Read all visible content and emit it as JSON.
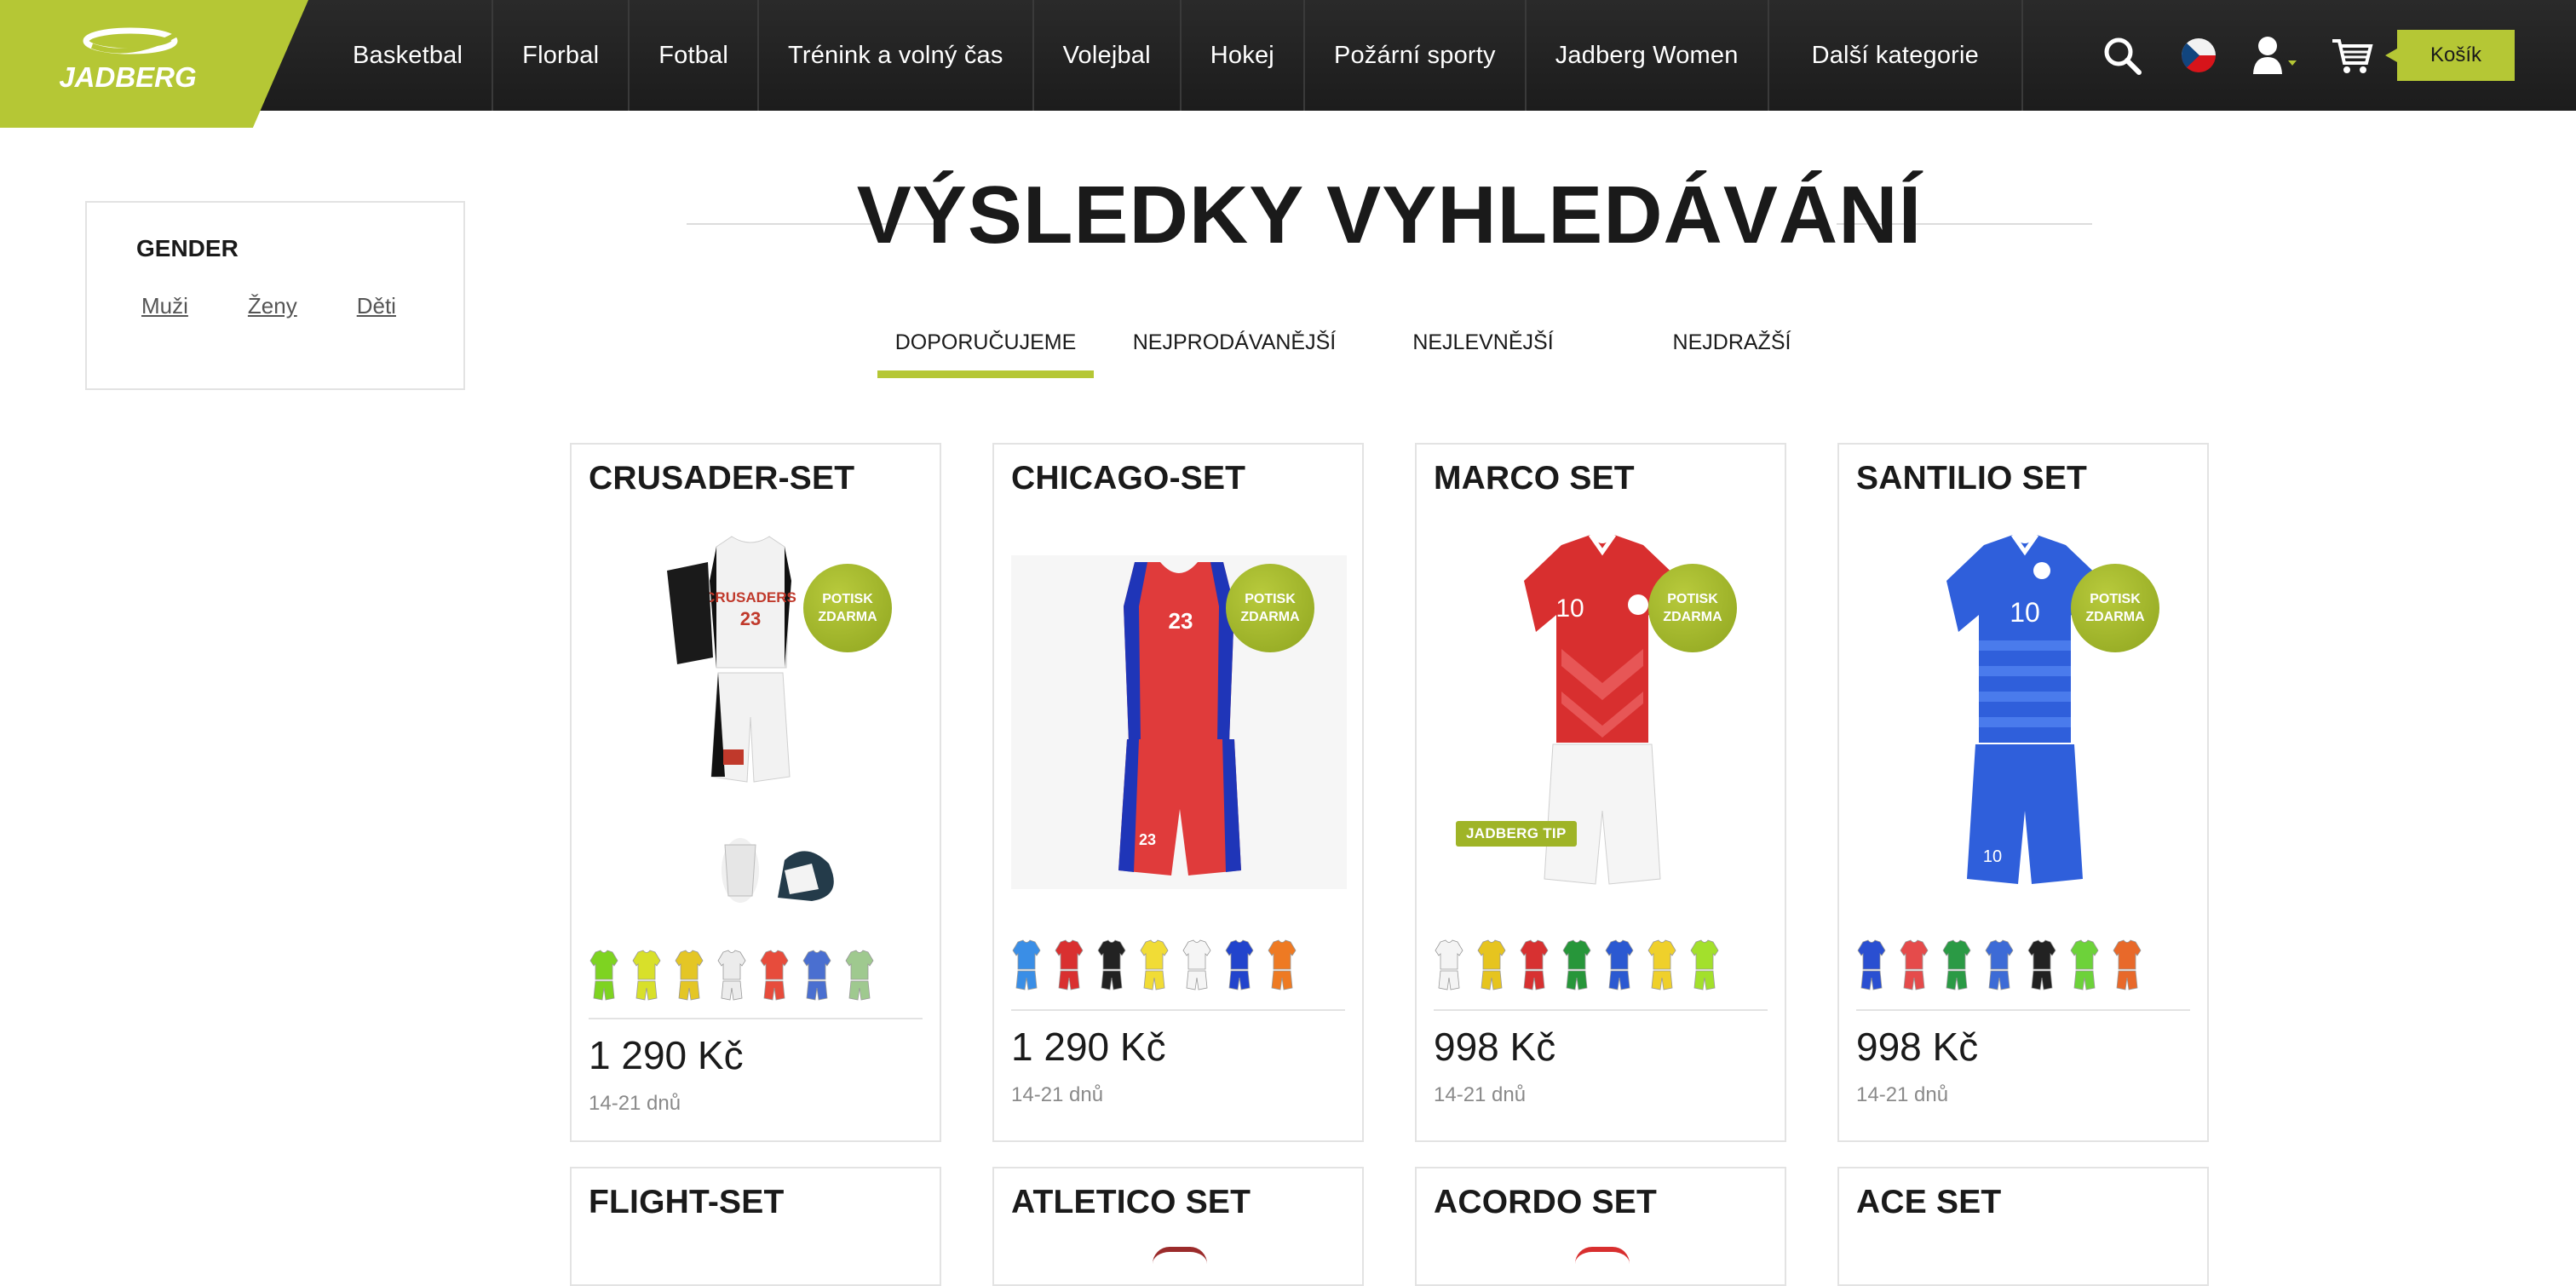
{
  "brand": {
    "logo_text": "JADBERG",
    "accent": "#b5c735"
  },
  "nav": {
    "items": [
      "Basketbal",
      "Florbal",
      "Fotbal",
      "Trénink a volný čas",
      "Volejbal",
      "Hokej",
      "Požární sporty",
      "Jadberg Women",
      "Další kategorie"
    ],
    "cart_label": "Košík",
    "icons": [
      "search-icon",
      "czech-flag-icon",
      "user-icon",
      "cart-icon"
    ]
  },
  "filter": {
    "title": "GENDER",
    "options": [
      "Muži",
      "Ženy",
      "Děti"
    ]
  },
  "page": {
    "title": "VÝSLEDKY VYHLEDÁVÁNÍ"
  },
  "sort": {
    "tabs": [
      "DOPORUČUJEME",
      "NEJPRODÁVANĚJŠÍ",
      "NEJLEVNĚJŠÍ",
      "NEJDRAŽŠÍ"
    ],
    "active": "DOPORUČUJEME"
  },
  "products": [
    {
      "name": "CRUSADER-SET",
      "price": "1 290 Kč",
      "delivery": "14-21 dnů",
      "badge": [
        "POTISK",
        "ZDARMA"
      ],
      "swatches": [
        "#7ed321",
        "#d8e02a",
        "#e4c625",
        "#ececec",
        "#e74c3c",
        "#4a6fd0",
        "#9fc98f"
      ]
    },
    {
      "name": "CHICAGO-SET",
      "price": "1 290 Kč",
      "delivery": "14-21 dnů",
      "badge": [
        "POTISK",
        "ZDARMA"
      ],
      "swatches": [
        "#3a8ee6",
        "#d93030",
        "#222222",
        "#f1dc36",
        "#f5f5f5",
        "#2244cc",
        "#ee7a23"
      ]
    },
    {
      "name": "MARCO SET",
      "price": "998 Kč",
      "delivery": "14-21 dnů",
      "badge": [
        "POTISK",
        "ZDARMA"
      ],
      "tip": "JADBERG TIP",
      "swatches": [
        "#f4f4f4",
        "#e6c41f",
        "#d73131",
        "#27963a",
        "#2b59d1",
        "#efd02b",
        "#a3e02c"
      ]
    },
    {
      "name": "SANTILIO SET",
      "price": "998 Kč",
      "delivery": "14-21 dnů",
      "badge": [
        "POTISK",
        "ZDARMA"
      ],
      "swatches": [
        "#2a4fd1",
        "#e54b4b",
        "#2b9a45",
        "#3d6bd6",
        "#222222",
        "#6dd23a",
        "#e8692a"
      ]
    },
    {
      "name": "FLIGHT-SET"
    },
    {
      "name": "ATLETICO SET"
    },
    {
      "name": "ACORDO SET"
    },
    {
      "name": "ACE SET"
    }
  ]
}
